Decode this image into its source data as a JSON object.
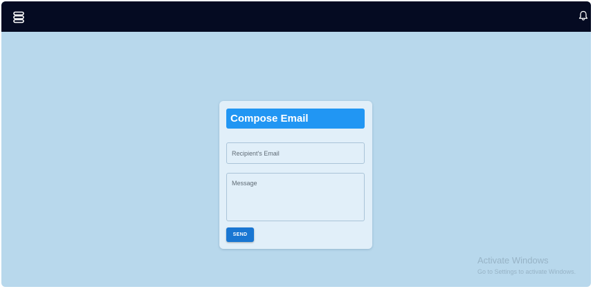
{
  "topbar": {
    "menu_icon": "menu-icon",
    "notification_icon": "bell-icon",
    "background": "#050b22"
  },
  "compose": {
    "title": "Compose Email",
    "recipient_placeholder": "Recipient's Email",
    "recipient_value": "",
    "message_placeholder": "Message",
    "message_value": "",
    "send_label": "SEND",
    "header_color": "#2196f3",
    "button_color": "#1976d2"
  },
  "watermark": {
    "title": "Activate Windows",
    "subtitle": "Go to Settings to activate Windows."
  },
  "colors": {
    "page_background": "#b8d8ec",
    "card_background": "#e1eff9"
  }
}
